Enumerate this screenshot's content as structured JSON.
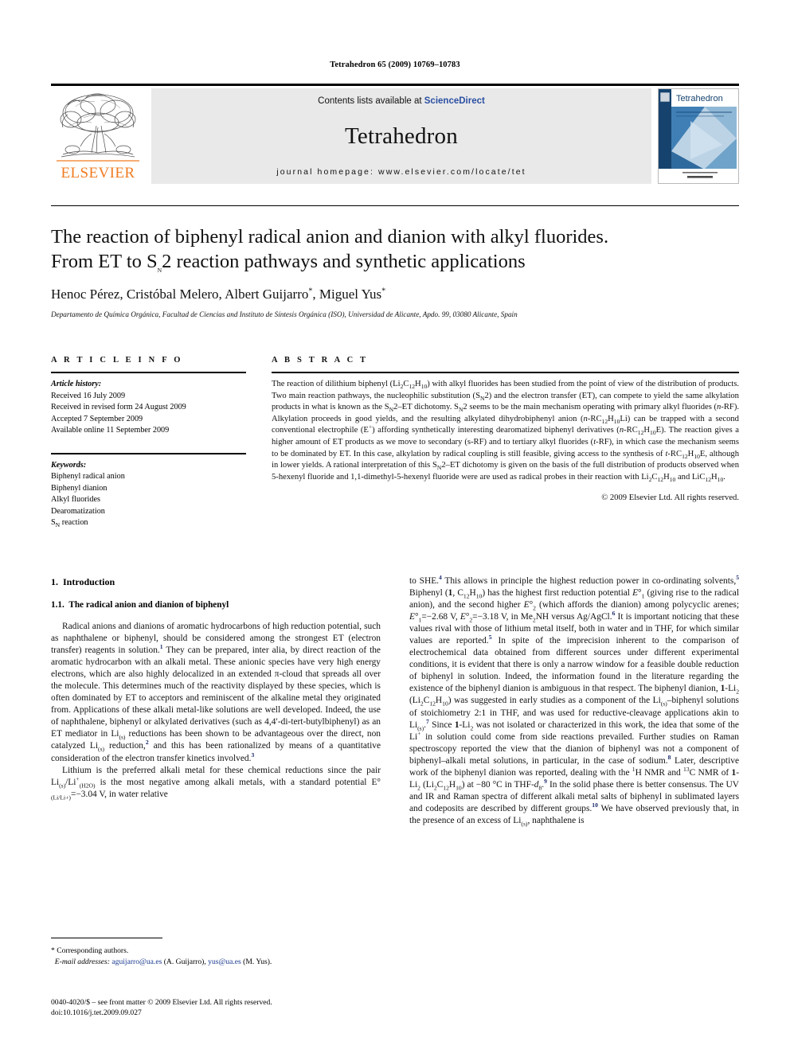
{
  "running_head": "Tetrahedron 65 (2009) 10769–10783",
  "masthead": {
    "publisher_name": "ELSEVIER",
    "contents_prefix": "Contents lists available at ",
    "contents_brand": "ScienceDirect",
    "journal_name": "Tetrahedron",
    "homepage": "journal homepage: www.elsevier.com/locate/tet",
    "cover_title": "Tetrahedron",
    "brand_color": "#F07C22",
    "link_color": "#2b4fa2"
  },
  "title": {
    "line1": "The reaction of biphenyl radical anion and dianion with alkyl fluorides.",
    "line2_a": "From ET to S",
    "line2_sub": "N",
    "line2_b": "2 reaction pathways and synthetic applications"
  },
  "authors": {
    "text": "Henoc Pérez, Cristóbal Melero, Albert Guijarro",
    "star1": "*",
    "text2": ", Miguel Yus",
    "star2": "*",
    "affiliation": "Departamento de Química Orgánica, Facultad de Ciencias and Instituto de Síntesis Orgánica (ISO), Universidad de Alicante, Apdo. 99, 03080 Alicante, Spain"
  },
  "article_info": {
    "heading": "A R T I C L E   I N F O",
    "history_label": "Article history:",
    "history": [
      "Received 16 July 2009",
      "Received in revised form 24 August 2009",
      "Accepted 7 September 2009",
      "Available online 11 September 2009"
    ],
    "keywords_label": "Keywords:",
    "keywords": [
      "Biphenyl radical anion",
      "Biphenyl dianion",
      "Alkyl fluorides",
      "Dearomatization"
    ],
    "keyword_sn_a": "S",
    "keyword_sn_sub": "N",
    "keyword_sn_b": " reaction"
  },
  "abstract": {
    "heading": "A B S T R A C T",
    "copyright": "© 2009 Elsevier Ltd. All rights reserved."
  },
  "body": {
    "section1_number": "1.",
    "section1_title": "Introduction",
    "subsection11_number": "1.1.",
    "subsection11_title": "The radical anion and dianion of biphenyl"
  },
  "footnote": {
    "corresponding": "* Corresponding authors.",
    "email_label": "E-mail addresses:",
    "email1": "aguijarro@ua.es",
    "email1_attr": " (A. Guijarro),",
    "email2": "yus@ua.es",
    "email2_attr": " (M. Yus)."
  },
  "issn": {
    "line1": "0040-4020/$ – see front matter © 2009 Elsevier Ltd. All rights reserved.",
    "line2": "doi:10.1016/j.tet.2009.09.027"
  }
}
